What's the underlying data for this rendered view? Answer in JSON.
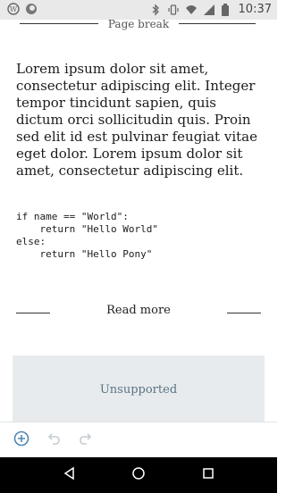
{
  "status_bar": {
    "time": "10:37",
    "icons": [
      "wordpress-icon",
      "circle-app-icon",
      "bluetooth-icon",
      "vibrate-icon",
      "wifi-icon",
      "signal-icon",
      "battery-icon"
    ]
  },
  "page_break": {
    "label": "Page break"
  },
  "paragraph": {
    "text": "Lorem ipsum dolor sit amet, consectetur adipiscing elit. Integer tempor tincidunt sapien, quis dictum orci sollicitudin quis. Proin sed elit id est pulvinar feugiat vitae eget dolor. Lorem ipsum dolor sit amet, consectetur adipiscing elit."
  },
  "code_block": {
    "text": "if name == \"World\":\n    return \"Hello World\"\nelse:\n    return \"Hello Pony\""
  },
  "read_more": {
    "label": "Read more"
  },
  "unsupported_block": {
    "label": "Unsupported"
  },
  "editor_toolbar": {
    "icons": [
      "add-block-icon",
      "undo-icon",
      "redo-icon"
    ],
    "colors": {
      "add": "#4f88b3",
      "disabled": "#c6ced3"
    }
  },
  "nav_bar": {
    "icons": [
      "back-icon",
      "home-icon",
      "recents-icon"
    ]
  }
}
